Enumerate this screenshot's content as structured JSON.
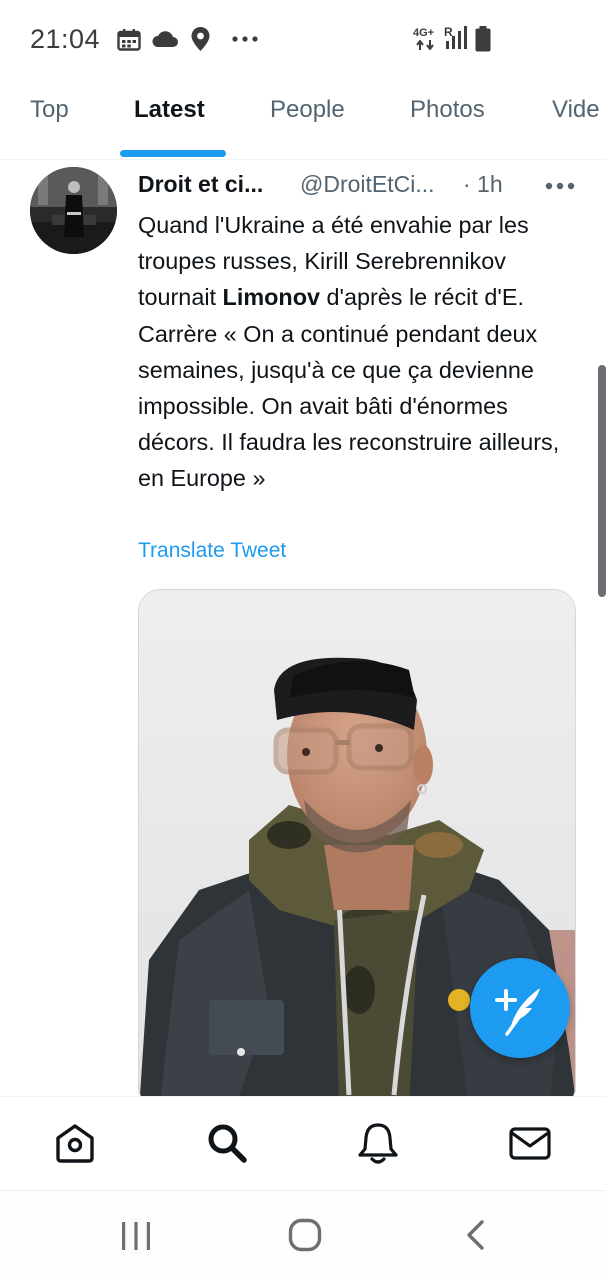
{
  "status_bar": {
    "time": "21:04",
    "icons": [
      "calendar-icon",
      "cloud-icon",
      "location-pin-icon",
      "more-dots-icon"
    ],
    "network_label": "4G+",
    "roaming_label": "R",
    "battery_icon": "battery-icon"
  },
  "tabs": [
    {
      "label": "Top",
      "active": false
    },
    {
      "label": "Latest",
      "active": true
    },
    {
      "label": "People",
      "active": false
    },
    {
      "label": "Photos",
      "active": false
    },
    {
      "label": "Vide",
      "active": false
    }
  ],
  "tweet": {
    "display_name": "Droit et ci...",
    "handle": "@DroitEtCi...",
    "time": "· 1h",
    "text_before": "Quand l'Ukraine a été envahie par les troupes russes, Kirill Serebrennikov tournait ",
    "text_bold": "Limonov",
    "text_after": " d'après le récit d'E. Carrère « On a continué pendant deux semaines, jusqu'à ce que ça devienne impossible. On avait bâti d'énormes décors. Il faudra les reconstruire ailleurs, en Europe »",
    "translate_label": "Translate Tweet"
  },
  "bottom_nav": [
    "home-icon",
    "search-icon",
    "notifications-bell-icon",
    "messages-envelope-icon"
  ],
  "system_nav": [
    "recent-apps-icon",
    "home-circle-icon",
    "back-chevron-icon"
  ],
  "colors": {
    "accent": "#1d9bf0",
    "text_primary": "#0f1419",
    "text_secondary": "#536471",
    "divider": "#eff3f4"
  }
}
